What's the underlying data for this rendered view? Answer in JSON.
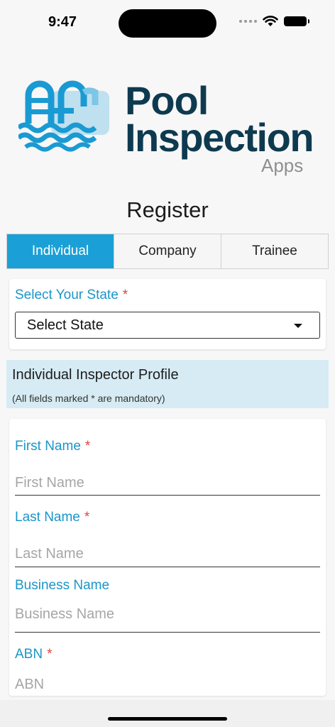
{
  "status_bar": {
    "time": "9:47",
    "icons": [
      "signal-dots-icon",
      "wifi-icon",
      "battery-icon"
    ]
  },
  "logo": {
    "line1": "Pool",
    "line2": "Inspection",
    "subtitle": "Apps",
    "colors": {
      "dark": "#0e3a4f",
      "light_blue": "#1aa0d6",
      "grey": "#8f8f8f"
    }
  },
  "page": {
    "title": "Register"
  },
  "tabs": [
    {
      "label": "Individual",
      "active": true
    },
    {
      "label": "Company",
      "active": false
    },
    {
      "label": "Trainee",
      "active": false
    }
  ],
  "state_selector": {
    "label": "Select Your State",
    "required_mark": "*",
    "value": "Select State",
    "icon": "caret-down-icon"
  },
  "profile": {
    "title": "Individual Inspector Profile",
    "note": "(All fields marked * are mandatory)"
  },
  "form": {
    "fields": [
      {
        "label": "First Name",
        "required_mark": "*",
        "placeholder": "First Name"
      },
      {
        "label": "Last Name",
        "required_mark": "*",
        "placeholder": "Last Name"
      },
      {
        "label": "Business Name",
        "required_mark": "",
        "placeholder": "Business Name"
      },
      {
        "label": "ABN",
        "required_mark": "*",
        "placeholder": "ABN"
      }
    ]
  },
  "theme": {
    "accent": "#1aa0d6",
    "label_color": "#1a96c9",
    "required_color": "#e0443a",
    "banner_bg": "#d6ebf3"
  }
}
